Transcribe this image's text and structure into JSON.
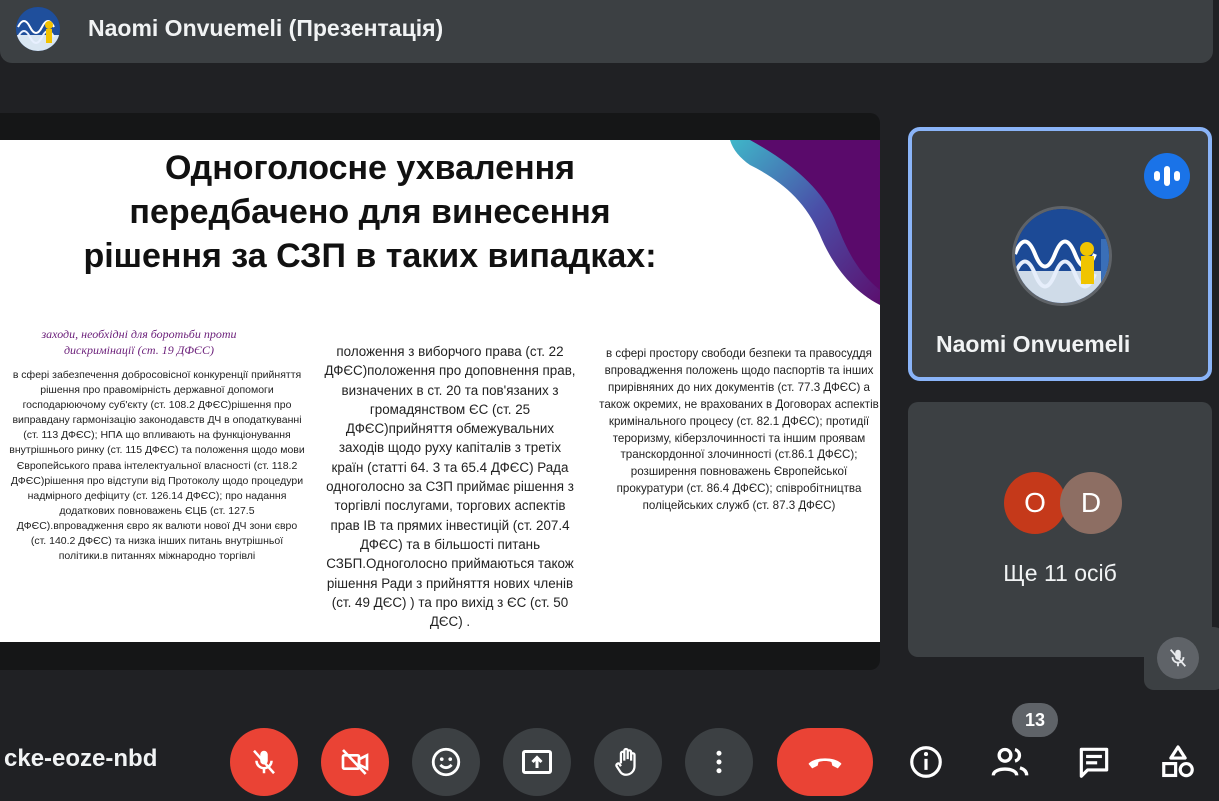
{
  "header": {
    "title": "Naomi Onvuemeli (Презентація)"
  },
  "slide": {
    "title": "Одноголосне ухвалення передбачено для винесення рішення за СЗП в таких випадках:",
    "col1_heading": "заходи, необхідні для боротьби проти дискримінації (ст. 19 ДФЄС)",
    "col1_text": "в сфері забезпечення добросовісної конкуренції прийняття рішення про правомірність державної допомоги господарюючому суб'єкту (ст. 108.2 ДФЄС)рішення про виправдану гармонізацію законодавств ДЧ в оподаткуванні (ст. 113 ДФЄС); НПА що впливають на функціонування внутрішнього ринку (ст. 115 ДФЄС) та положення щодо мови Європейського права інтелектуальної власності (ст. 118.2 ДФЄС)рішення про відступи від Протоколу щодо процедури надмірного дефіциту (ст. 126.14 ДФЄС); про надання додаткових повноважень ЄЦБ (ст. 127.5 ДФЄС).впровадження євро як валюти нової ДЧ зони євро (ст. 140.2 ДФЄС) та низка інших питань внутрішньої політики.в питаннях міжнародно торгівлі",
    "col2_text": "положення з виборчого права (ст. 22 ДФЄС)положення про доповнення прав, визначених в ст. 20 та пов'язаних з громадянством ЄС (ст. 25 ДФЄС)прийняття обмежувальних заходів щодо руху капіталів з третіх країн (статті 64. 3 та 65.4 ДФЄС) Рада одноголосно за СЗП приймає рішення з торгівлі послугами, торгових аспектів прав ІВ та прямих інвестицій (ст. 207.4 ДФЄС) та в більшості питань СЗБП.Одноголосно приймаються також рішення Ради з прийняття нових членів (ст. 49 ДЄС) ) та про вихід з ЄС (ст. 50 ДЄС) .",
    "col3_text": "в сфері простору свободи безпеки та правосуддя впровадження положень щодо паспортів та інших прирівняних до них документів (ст. 77.3 ДФЄС) а також окремих, не врахованих в Договорах аспектів кримінального процесу (ст. 82.1 ДФЄС); протидії тероризму, кіберзлочинності та іншим проявам транскордонної злочинності (ст.86.1 ДФЄС); розширення повноважень Європейської прокуратури (ст. 86.4 ДФЄС); співробітництва поліцейських служб (ст. 87.3 ДФЄС)"
  },
  "participants": {
    "active_name": "Naomi Onvuemeli",
    "others": [
      {
        "initial": "O",
        "color": "#c5391a"
      },
      {
        "initial": "D",
        "color": "#8d6e63"
      }
    ],
    "others_label": "Ще 11 осіб"
  },
  "toolbar": {
    "meeting_code": "cke-eoze-nbd",
    "people_count": "13"
  },
  "colors": {
    "accent": "#8ab4f8",
    "danger": "#ea4335",
    "speaking": "#1a73e8"
  }
}
